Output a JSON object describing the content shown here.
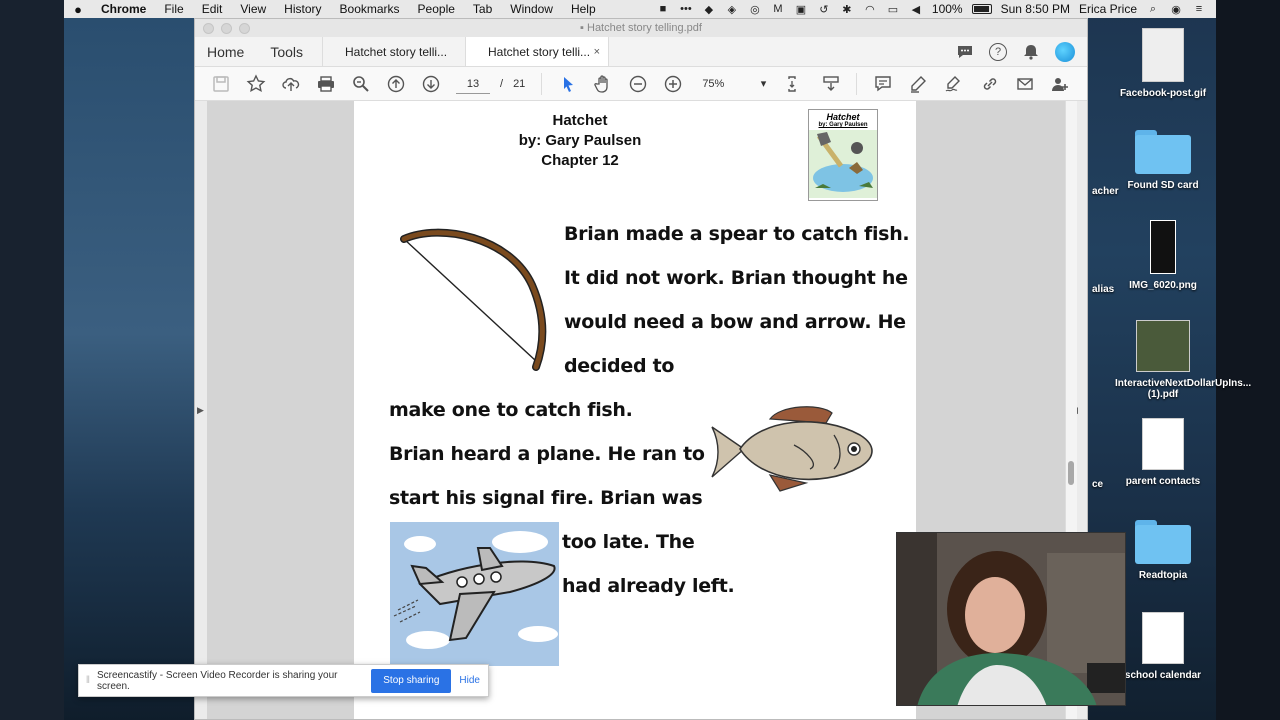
{
  "menubar": {
    "apple": "",
    "items": [
      "Chrome",
      "File",
      "Edit",
      "View",
      "History",
      "Bookmarks",
      "People",
      "Tab",
      "Window",
      "Help"
    ],
    "battery": "100%",
    "clock": "Sun 8:50 PM",
    "user": "Erica Price"
  },
  "window": {
    "title": "Hatchet story telling.pdf"
  },
  "app_nav": {
    "home": "Home",
    "tools": "Tools"
  },
  "tabs": [
    {
      "label": "Hatchet story telli...",
      "active": false
    },
    {
      "label": "Hatchet story telli...",
      "active": true,
      "close": "×"
    }
  ],
  "toolbar": {
    "current_page": "13",
    "page_separator": "/",
    "total_pages": "21",
    "zoom": "75%"
  },
  "document": {
    "title": "Hatchet",
    "author": "by: Gary Paulsen",
    "chapter": "Chapter 12",
    "cover_title": "Hatchet",
    "cover_author": "by: Gary Paulsen",
    "lines": [
      "Brian made a spear to catch fish.",
      "It did not work. Brian thought he",
      "would need a bow and arrow. He",
      "decided to",
      "make one to catch fish.",
      "Brian heard a plane. He ran to",
      "start his signal fire. Brian was",
      "too late. The",
      "had already left."
    ]
  },
  "desktop_icons": [
    {
      "label": "Facebook-post.gif",
      "icon": "image-file-icon"
    },
    {
      "label": "Found SD card",
      "icon": "folder-icon"
    },
    {
      "label": "IMG_6020.png",
      "icon": "image-file-icon"
    },
    {
      "label": "InteractiveNextDollarUpIns...(1).pdf",
      "icon": "pdf-file-icon"
    },
    {
      "label": "parent contacts",
      "icon": "document-icon"
    },
    {
      "label": "Readtopia",
      "icon": "folder-icon"
    },
    {
      "label": "school calendar",
      "icon": "document-icon"
    }
  ],
  "desktop_clipped_labels": [
    "acher",
    "alias",
    "ce"
  ],
  "screencastify": {
    "message": "Screencastify - Screen Video Recorder is sharing your screen.",
    "stop": "Stop sharing",
    "hide": "Hide"
  },
  "colors": {
    "accent_blue": "#2a72e5",
    "bow_brown": "#7a4a1e",
    "sky_blue": "#a9c7e6"
  }
}
